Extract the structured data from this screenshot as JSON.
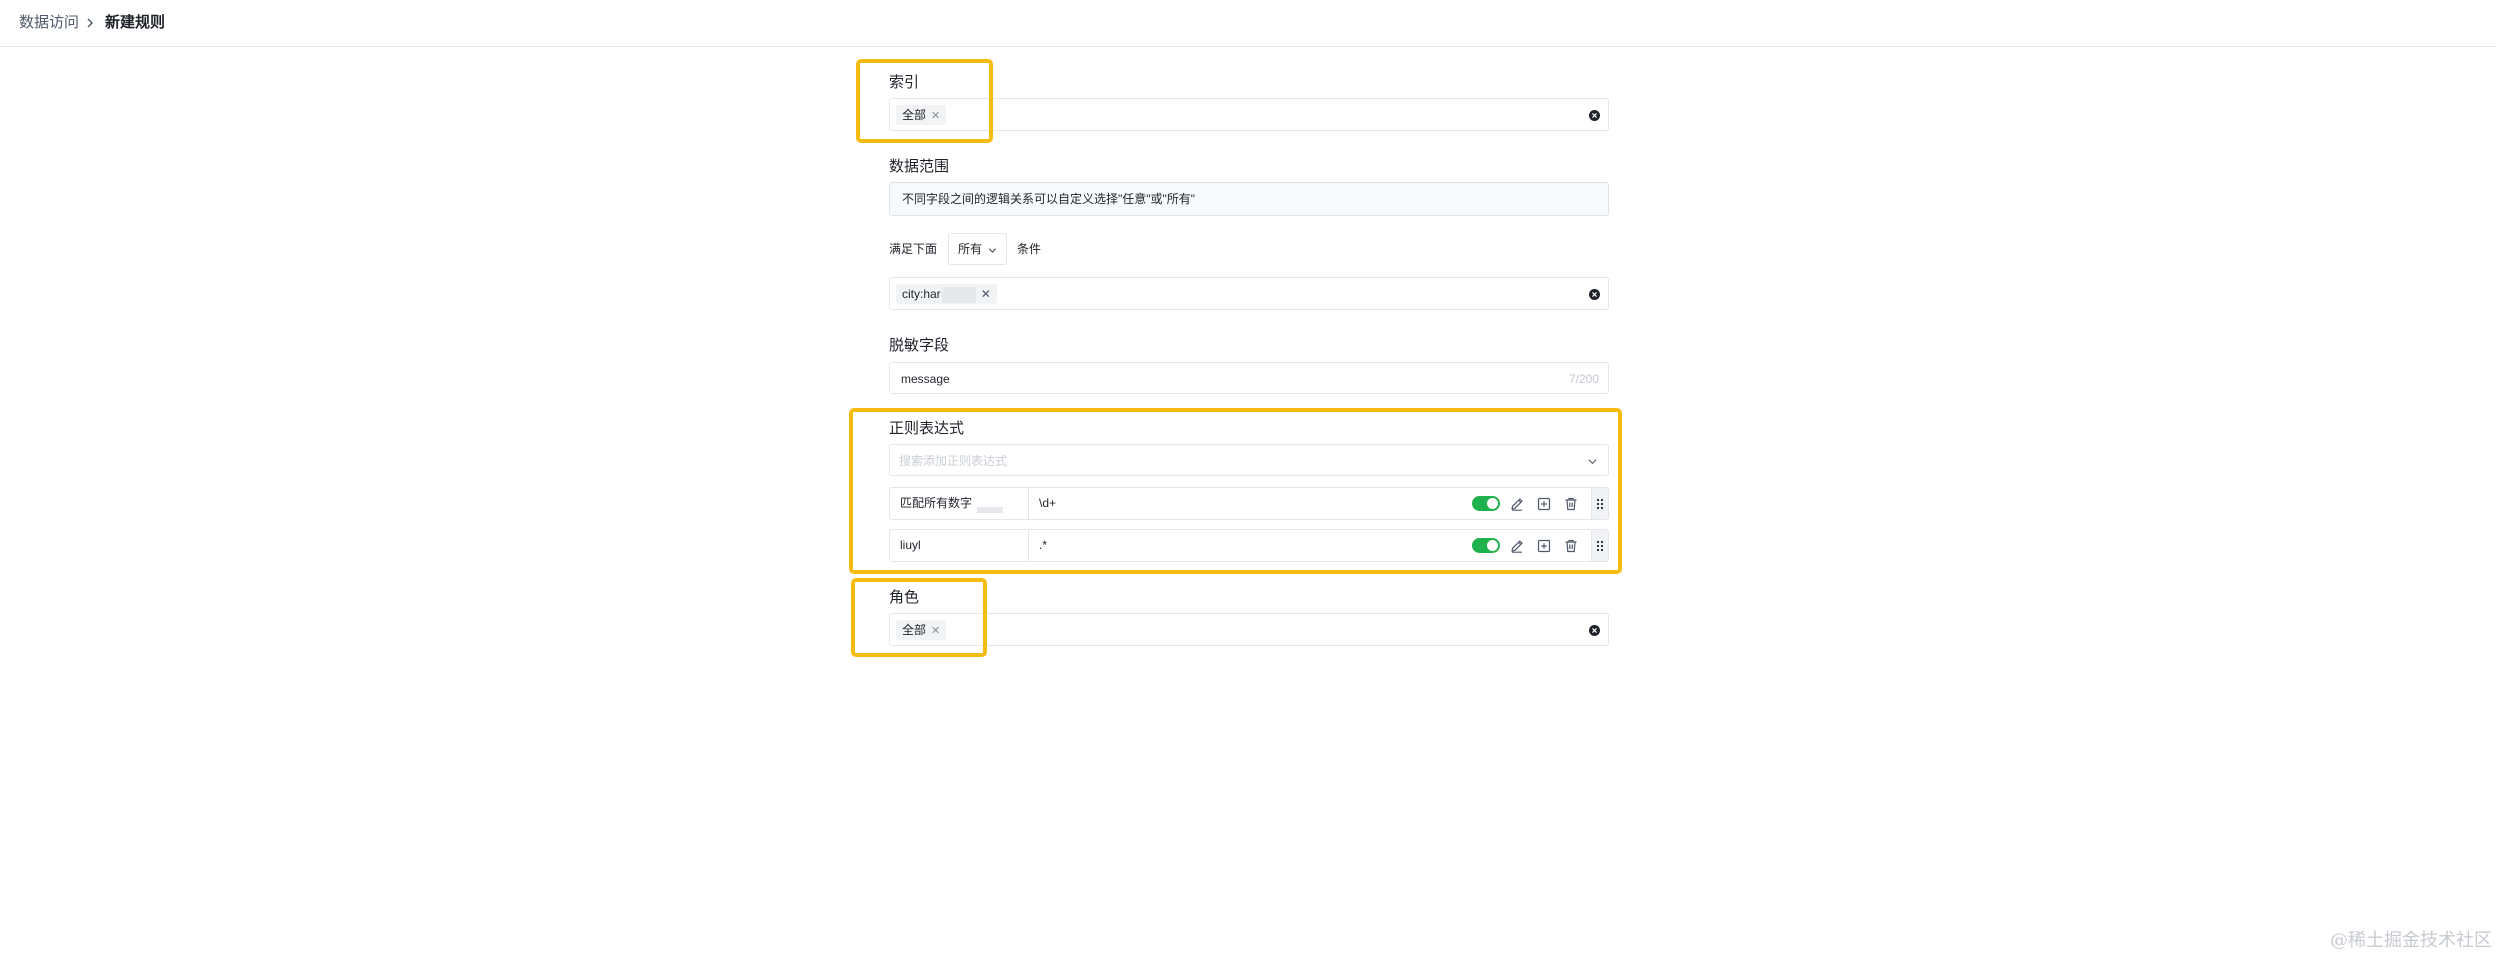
{
  "breadcrumb": {
    "parent": "数据访问",
    "current": "新建规则"
  },
  "index_section": {
    "label": "索引",
    "tags": [
      {
        "text": "全部"
      }
    ]
  },
  "data_scope": {
    "label": "数据范围",
    "hint": "不同字段之间的逻辑关系可以自定义选择\"任意\"或\"所有\"",
    "condition_prefix": "满足下面",
    "condition_value": "所有",
    "condition_suffix": "条件",
    "tags": [
      {
        "text": "city:har"
      }
    ]
  },
  "mask_field": {
    "label": "脱敏字段",
    "value": "message",
    "counter": "7/200"
  },
  "regex": {
    "label": "正则表达式",
    "placeholder": "搜索添加正则表达式",
    "rows": [
      {
        "name": "匹配所有数字",
        "pattern": "\\d+",
        "enabled": true
      },
      {
        "name": "liuyl",
        "pattern": ".*",
        "enabled": true
      }
    ]
  },
  "role_section": {
    "label": "角色",
    "tags": [
      {
        "text": "全部"
      }
    ]
  },
  "icons": {
    "breadcrumb_sep": "chevron-right-icon",
    "clear": "clear-circle-icon",
    "dropdown": "chevron-down-icon",
    "edit": "pencil-icon",
    "copy": "square-plus-icon",
    "delete": "trash-icon",
    "drag": "drag-handle-icon"
  },
  "colors": {
    "highlight": "#f5bd14",
    "toggle_on": "#1fb14c",
    "info_bg": "#f7f9fb"
  },
  "watermark": "@稀土掘金技术社区"
}
